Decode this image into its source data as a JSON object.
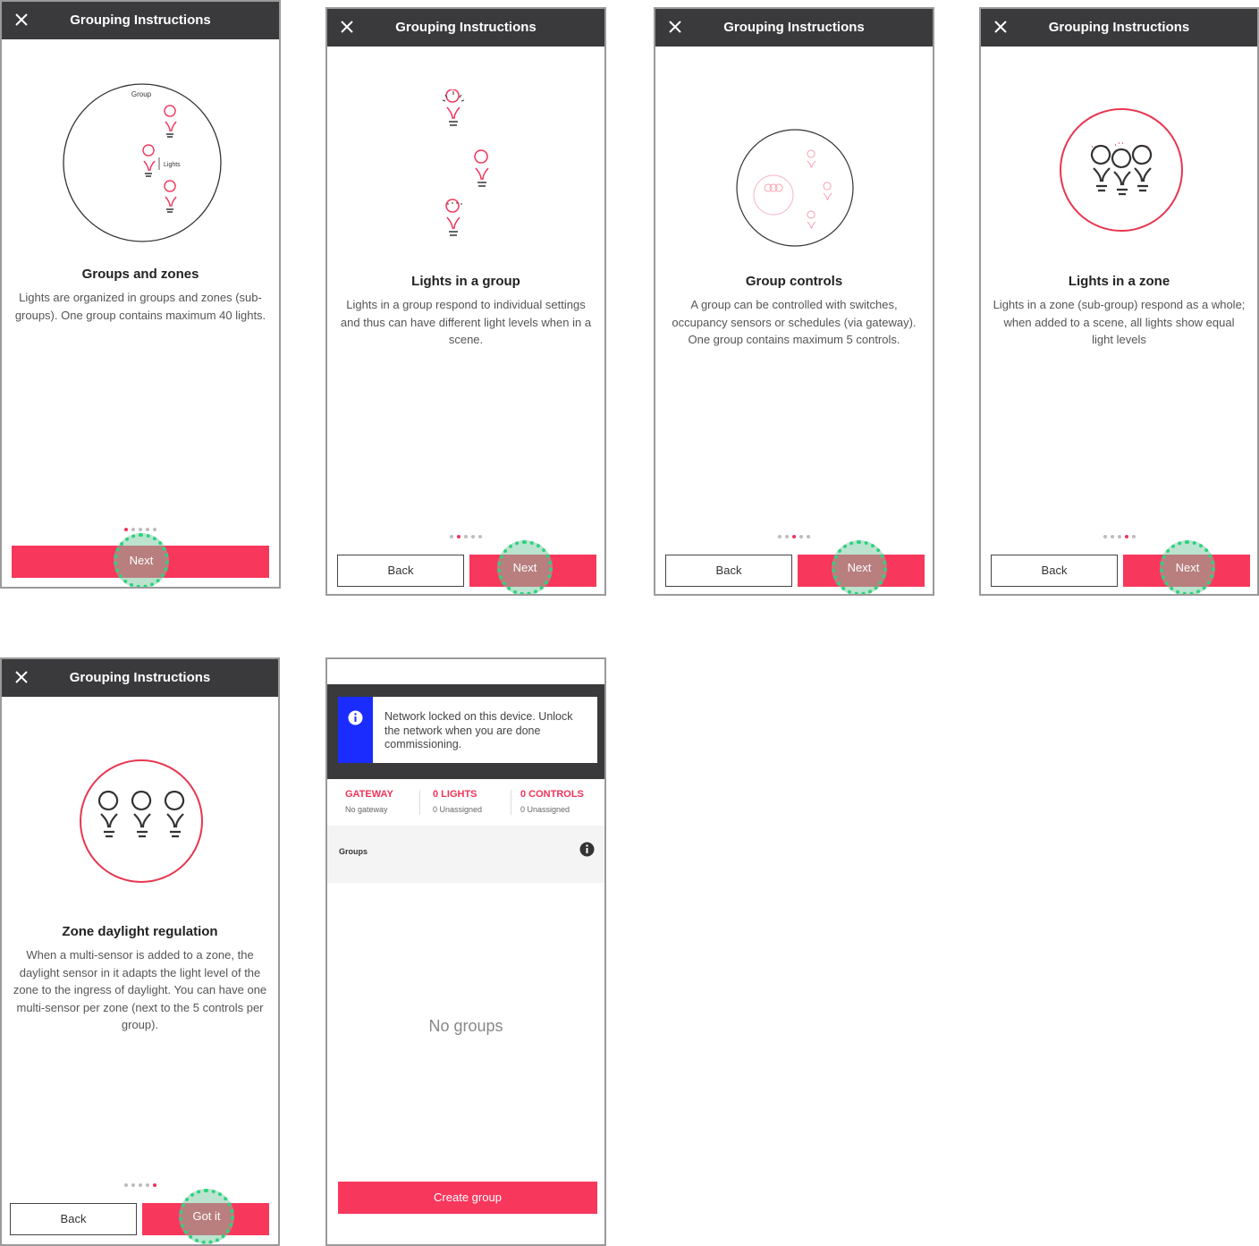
{
  "colors": {
    "accent": "#f8375c",
    "appbar": "#3a3a3d",
    "info_blue": "#1a2cff",
    "tap_highlight": "#2bd47e"
  },
  "appbar": {
    "title": "Grouping Instructions",
    "close_icon": "close-icon"
  },
  "common": {
    "next": "Next",
    "back": "Back",
    "got_it": "Got it"
  },
  "screen1": {
    "diagram": {
      "group": "Group",
      "lights": "Lights"
    },
    "heading": "Groups and zones",
    "text": "Lights are organized in groups and zones (sub-groups). One group contains maximum 40 lights.",
    "page": 1,
    "pages": 5
  },
  "screen2": {
    "heading": "Lights in a group",
    "text": "Lights in a group respond to individual settings and thus can have different light levels when in a scene.",
    "page": 2,
    "pages": 5
  },
  "screen3": {
    "heading": "Group controls",
    "text": "A group can be controlled with switches, occupancy sensors or schedules (via gateway). One group contains maximum 5 controls.",
    "page": 3,
    "pages": 5
  },
  "screen4": {
    "heading": "Lights in a zone",
    "text": "Lights in a zone (sub-group) respond as a whole; when added to a scene, all lights show equal light levels",
    "page": 4,
    "pages": 5
  },
  "screen5": {
    "heading": "Zone daylight regulation",
    "text": "When a multi-sensor is added to a zone, the daylight sensor in it adapts the light level of the zone to the ingress of daylight. You can have one multi-sensor per zone (next to the 5 controls per group).",
    "page": 5,
    "pages": 5
  },
  "screen6": {
    "banner": "Network locked on this device. Unlock the network when you are done commissioning.",
    "stats": [
      {
        "title": "GATEWAY",
        "sub": "No gateway"
      },
      {
        "title": "0 LIGHTS",
        "sub": "0 Unassigned"
      },
      {
        "title": "0 CONTROLS",
        "sub": "0 Unassigned"
      }
    ],
    "groups_label": "Groups",
    "empty": "No groups",
    "create": "Create group"
  }
}
